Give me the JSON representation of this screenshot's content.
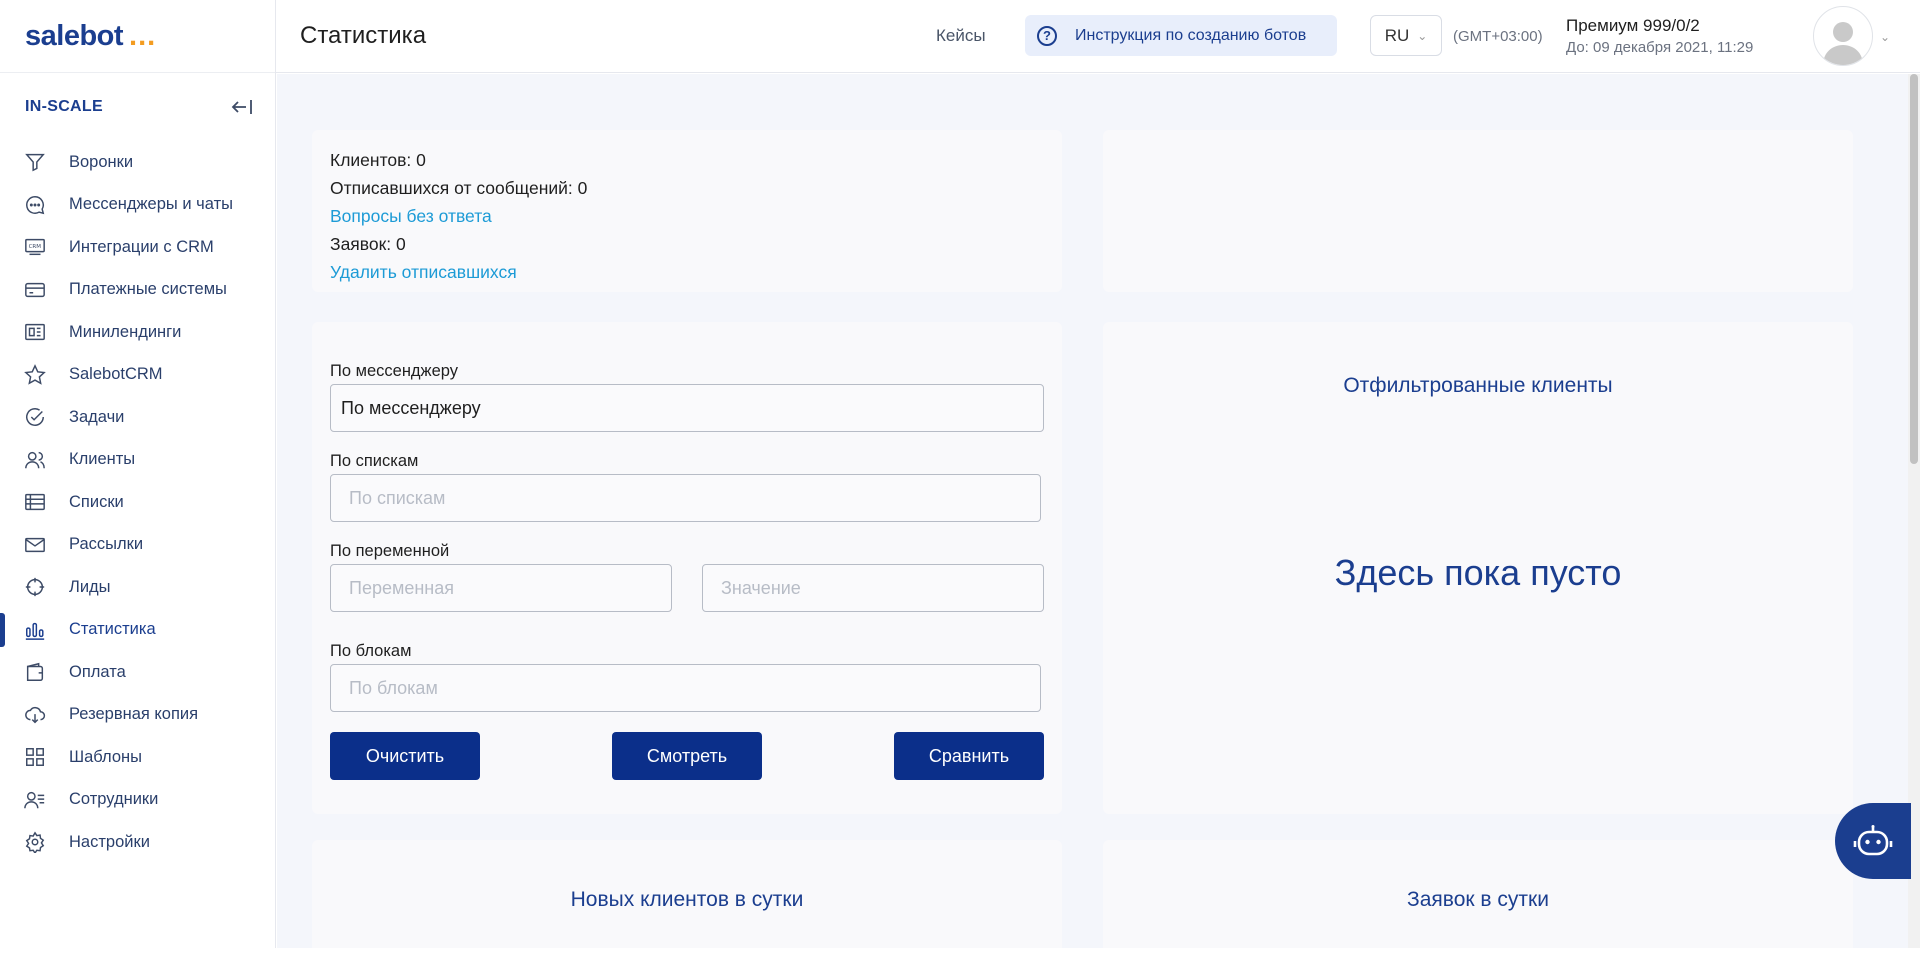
{
  "logo": {
    "text": "salebot",
    "dots": "..."
  },
  "sidebar": {
    "org_name": "IN-SCALE",
    "items": [
      {
        "label": "Воронки",
        "icon": "funnel-icon"
      },
      {
        "label": "Мессенджеры и чаты",
        "icon": "chat-icon"
      },
      {
        "label": "Интеграции с CRM",
        "icon": "crm-icon"
      },
      {
        "label": "Платежные системы",
        "icon": "card-icon"
      },
      {
        "label": "Минилендинги",
        "icon": "landing-icon"
      },
      {
        "label": "SalebotCRM",
        "icon": "star-icon"
      },
      {
        "label": "Задачи",
        "icon": "check-circle-icon"
      },
      {
        "label": "Клиенты",
        "icon": "users-icon"
      },
      {
        "label": "Списки",
        "icon": "list-icon"
      },
      {
        "label": "Рассылки",
        "icon": "mail-icon"
      },
      {
        "label": "Лиды",
        "icon": "target-icon"
      },
      {
        "label": "Статистика",
        "icon": "bar-chart-icon",
        "active": true
      },
      {
        "label": "Оплата",
        "icon": "wallet-icon"
      },
      {
        "label": "Резервная копия",
        "icon": "cloud-download-icon"
      },
      {
        "label": "Шаблоны",
        "icon": "grid-icon"
      },
      {
        "label": "Сотрудники",
        "icon": "staff-icon"
      },
      {
        "label": "Настройки",
        "icon": "gear-icon"
      }
    ]
  },
  "header": {
    "title": "Статистика",
    "cases": "Кейсы",
    "guide": "Инструкция по созданию ботов",
    "lang": "RU",
    "timezone": "(GMT+03:00)",
    "plan_name": "Премиум 999/0/2",
    "plan_until": "До: 09 декабря 2021, 11:29"
  },
  "stats": {
    "clients": "Клиентов: 0",
    "unsubscribed": "Отписавшихся от сообщений: 0",
    "unanswered": "Вопросы без ответа",
    "orders": "Заявок: 0",
    "delete_unsubscribed": "Удалить отписавшихся"
  },
  "filters": {
    "messenger_label": "По мессенджеру",
    "messenger_value": "По мессенджеру",
    "lists_label": "По спискам",
    "lists_placeholder": "По спискам",
    "variable_label": "По переменной",
    "variable_placeholder": "Переменная",
    "value_placeholder": "Значение",
    "blocks_label": "По блокам",
    "blocks_placeholder": "По блокам",
    "clear": "Очистить",
    "view": "Смотреть",
    "compare": "Сравнить"
  },
  "filtered": {
    "title": "Отфильтрованные клиенты",
    "empty": "Здесь пока пусто"
  },
  "daily": {
    "new_clients": "Новых клиентов в сутки",
    "orders": "Заявок в сутки"
  },
  "colors": {
    "brand": "#1b3e8f",
    "button": "#0b2f8a",
    "link": "#1d9bd6",
    "accent_dots": "#f39c21"
  }
}
